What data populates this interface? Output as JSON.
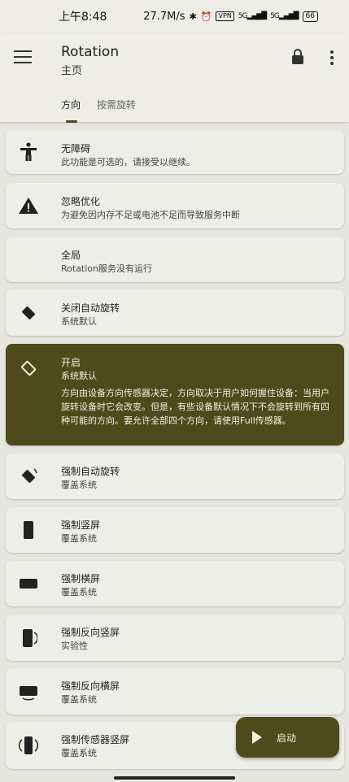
{
  "status_bar": {
    "time": "上午8:48",
    "speed": "27.7M/s",
    "bluetooth_icon": "bluetooth-icon",
    "alarm_icon": "alarm-icon",
    "vpn": "VPN",
    "signal1": "5G",
    "signal2": "5G",
    "battery": "66"
  },
  "app_bar": {
    "title": "Rotation",
    "subtitle": "主页",
    "tabs": [
      {
        "label": "方向"
      },
      {
        "label": "按需旋转"
      }
    ]
  },
  "cards": [
    {
      "title": "无障碍",
      "sub": "此功能是可选的，请接受以继续。",
      "icon": "accessibility-icon"
    },
    {
      "title": "忽略优化",
      "sub": "为避免因内存不足或电池不足而导致服务中断",
      "icon": "warning-icon"
    },
    {
      "title": "全局",
      "sub": "Rotation服务没有运行",
      "icon": ""
    },
    {
      "title": "关闭自动旋转",
      "sub": "系统默认",
      "icon": "rotate-off-icon"
    },
    {
      "title": "开启",
      "sub": "系统默认",
      "icon": "auto-rotate-icon",
      "desc": "方向由设备方向传感器决定，方向取决于用户如何握住设备：当用户旋转设备时它会改变。但是，有些设备默认情况下不会旋转到所有四种可能的方向。要允许全部四个方向，请使用Full传感器。"
    },
    {
      "title": "强制自动旋转",
      "sub": "覆盖系统",
      "icon": "force-rotate-icon"
    },
    {
      "title": "强制竖屏",
      "sub": "覆盖系统",
      "icon": "portrait-icon"
    },
    {
      "title": "强制横屏",
      "sub": "覆盖系统",
      "icon": "landscape-icon"
    },
    {
      "title": "强制反向竖屏",
      "sub": "实验性",
      "icon": "reverse-portrait-icon"
    },
    {
      "title": "强制反向横屏",
      "sub": "覆盖系统",
      "icon": "reverse-landscape-icon"
    },
    {
      "title": "强制传感器竖屏",
      "sub": "覆盖系统",
      "icon": "sensor-portrait-icon"
    }
  ],
  "fab": {
    "label": "启动",
    "icon": "play-icon"
  },
  "colors": {
    "accent": "#4c4b1c",
    "background": "#e7e5df",
    "card": "#eeeee9"
  }
}
